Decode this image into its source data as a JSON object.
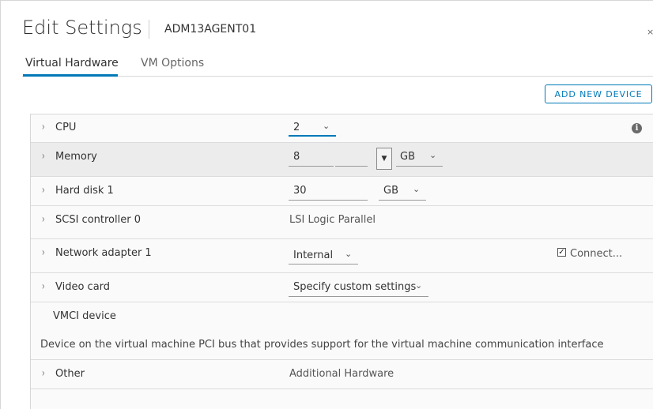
{
  "dialog": {
    "title": "Edit Settings",
    "vm_name": "ADM13AGENT01",
    "close_glyph": "×"
  },
  "tabs": [
    {
      "label": "Virtual Hardware",
      "active": true
    },
    {
      "label": "VM Options",
      "active": false
    }
  ],
  "toolbar": {
    "add_device_label": "ADD NEW DEVICE"
  },
  "hardware": {
    "cpu": {
      "label": "CPU",
      "value": "2"
    },
    "memory": {
      "label": "Memory",
      "value": "8",
      "unit": "GB"
    },
    "hard_disk": {
      "label": "Hard disk 1",
      "value": "30",
      "unit": "GB"
    },
    "scsi": {
      "label": "SCSI controller 0",
      "value": "LSI Logic Parallel"
    },
    "network": {
      "label": "Network adapter 1",
      "value": "Internal",
      "connect_label": "Connect...",
      "connected": true
    },
    "video": {
      "label": "Video card",
      "value": "Specify custom settings"
    },
    "vmci": {
      "label": "VMCI device",
      "description": "Device on the virtual machine PCI bus that provides support for the virtual machine communication interface"
    },
    "other": {
      "label": "Other",
      "value": "Additional Hardware"
    }
  },
  "icons": {
    "chevron": "›",
    "caret": "⌄",
    "info": "i",
    "spin": "▼",
    "check": "✓"
  },
  "colors": {
    "accent": "#0079b8",
    "row_shaded": "#ececec"
  }
}
